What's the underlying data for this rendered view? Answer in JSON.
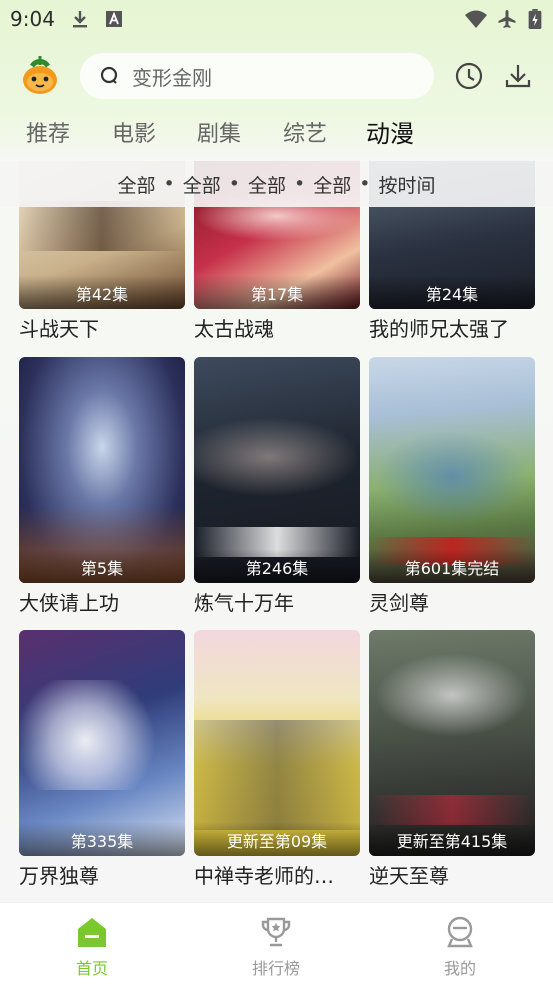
{
  "status": {
    "time": "9:04"
  },
  "search": {
    "placeholder": "变形金刚"
  },
  "tabs": [
    "推荐",
    "电影",
    "剧集",
    "综艺",
    "动漫"
  ],
  "active_tab": "动漫",
  "filter": [
    "全部",
    "全部",
    "全部",
    "全部",
    "按时间"
  ],
  "filter_separator": "•",
  "cards": [
    {
      "title": "斗战天下",
      "badge": "第42集"
    },
    {
      "title": "太古战魂",
      "badge": "第17集"
    },
    {
      "title": "我的师兄太强了",
      "badge": "第24集"
    },
    {
      "title": "大侠请上功",
      "badge": "第5集"
    },
    {
      "title": "炼气十万年",
      "badge": "第246集"
    },
    {
      "title": "灵剑尊",
      "badge": "第601集完结"
    },
    {
      "title": "万界独尊",
      "badge": "第335集"
    },
    {
      "title": "中禅寺老师的…",
      "badge": "更新至第09集"
    },
    {
      "title": "逆天至尊",
      "badge": "更新至第415集"
    }
  ],
  "bottom_nav": [
    {
      "label": "首页",
      "icon": "home-icon",
      "active": true
    },
    {
      "label": "排行榜",
      "icon": "trophy-icon",
      "active": false
    },
    {
      "label": "我的",
      "icon": "profile-icon",
      "active": false
    }
  ],
  "colors": {
    "accent": "#7ac82e",
    "header_bg": "#e6f5d3"
  }
}
